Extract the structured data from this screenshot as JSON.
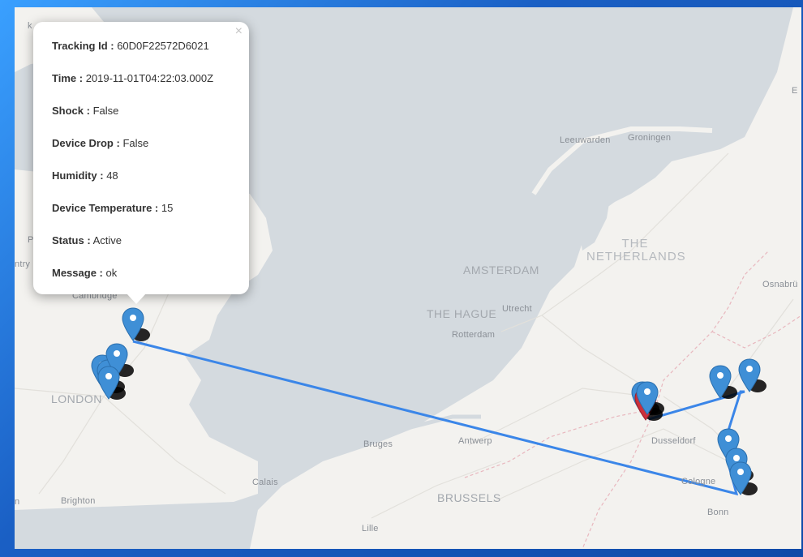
{
  "popup": {
    "close_icon": "×",
    "rows": [
      {
        "label": "Tracking Id :",
        "value": "60D0F22572D6021"
      },
      {
        "label": "Time :",
        "value": "2019-11-01T04:22:03.000Z"
      },
      {
        "label": "Shock :",
        "value": "False"
      },
      {
        "label": "Device Drop :",
        "value": "False"
      },
      {
        "label": "Humidity :",
        "value": "48"
      },
      {
        "label": "Device Temperature :",
        "value": "15"
      },
      {
        "label": "Status :",
        "value": "Active"
      },
      {
        "label": "Message :",
        "value": "ok"
      }
    ]
  },
  "map_labels": {
    "london": "LONDON",
    "cambridge": "Cambridge",
    "brighton": "Brighton",
    "calais": "Calais",
    "lille": "Lille",
    "bruges": "Bruges",
    "antwerp": "Antwerp",
    "brussels": "BRUSSELS",
    "the_hague": "THE HAGUE",
    "amsterdam": "AMSTERDAM",
    "utrecht": "Utrecht",
    "rotterdam": "Rotterdam",
    "leeuwarden": "Leeuwarden",
    "groningen": "Groningen",
    "netherlands_1": "THE",
    "netherlands_2": "NETHERLANDS",
    "dusseldorf": "Dusseldorf",
    "cologne": "Cologne",
    "bonn": "Bonn",
    "osnabruck": "Osnabrü",
    "edge_left_1": "k",
    "edge_left_2": "P",
    "edge_left_3": "ntry",
    "edge_right_1": "E",
    "edge_left_4": "n"
  },
  "colors": {
    "route": "#3b86e8",
    "marker_blue": "#3f8fd6",
    "marker_red": "#cc2f3a",
    "water": "#d4dadf",
    "land": "#f3f2ef"
  },
  "icons": {
    "marker": "map-pin-icon",
    "close": "close-icon"
  }
}
